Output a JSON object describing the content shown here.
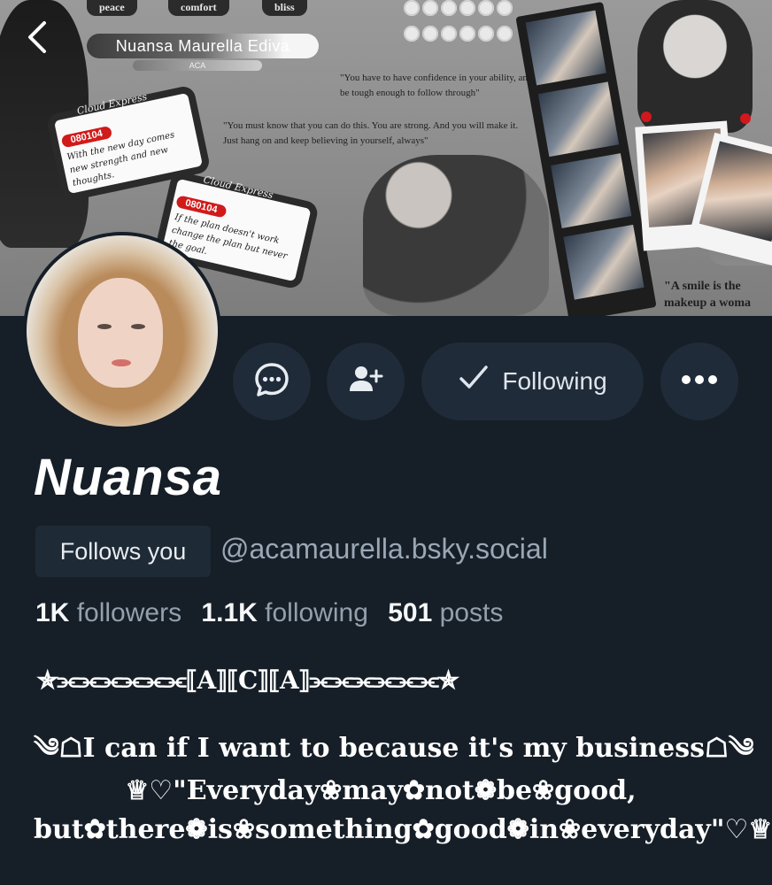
{
  "banner": {
    "tags": [
      "peace",
      "comfort",
      "bliss"
    ],
    "name_plate": "Nuansa Maurella Ediva",
    "name_sub": "ACA",
    "quote_1": "\"You have to have confidence in your ability, and then be tough enough to follow through\"",
    "quote_2": "\"You must know that you can do this. You are strong. And you will make it. Just hang on and keep believing in yourself, always\"",
    "quote_3": "\"A smile is the makeup a woma",
    "tickets": [
      {
        "script": "Cloud Express",
        "code": "080104",
        "text": "With the new day comes new strength and new thoughts."
      },
      {
        "script": "Cloud Express",
        "code": "080104",
        "text": "If the plan doesn't work change the plan but never the goal."
      }
    ]
  },
  "nav": {
    "back_icon": "chevron-left-icon"
  },
  "actions": {
    "message_icon": "chat-bubble-icon",
    "add_user_icon": "add-user-icon",
    "following_label": "Following",
    "following_icon": "check-icon",
    "more_icon": "ellipsis-icon"
  },
  "profile": {
    "display_name": "Nuansa",
    "follows_you": "Follows you",
    "handle": "@acamaurella.bsky.social",
    "followers_count": "1K",
    "followers_label": "followers",
    "following_count": "1.1K",
    "following_label": "following",
    "posts_count": "501",
    "posts_label": "posts",
    "bio_line_1": "✯⫘⫘⫘⫘⫘⫘⟦A⟧⟦C⟧⟦A⟧⫘⫘⫘⫘⫘⫘✯",
    "bio_line_2": "༄☖I can if I want to because it's my business☖༄",
    "bio_line_3": "♕♡\"Everyday❀may✿not❁be❀good,",
    "bio_line_4": "but✿there❁is❀something✿good❁in❀everyday\"♡♕"
  },
  "colors": {
    "background": "#161e27",
    "button_bg": "#1f2b39",
    "muted_text": "#93a0ad",
    "badge_bg": "#1f2a37"
  }
}
